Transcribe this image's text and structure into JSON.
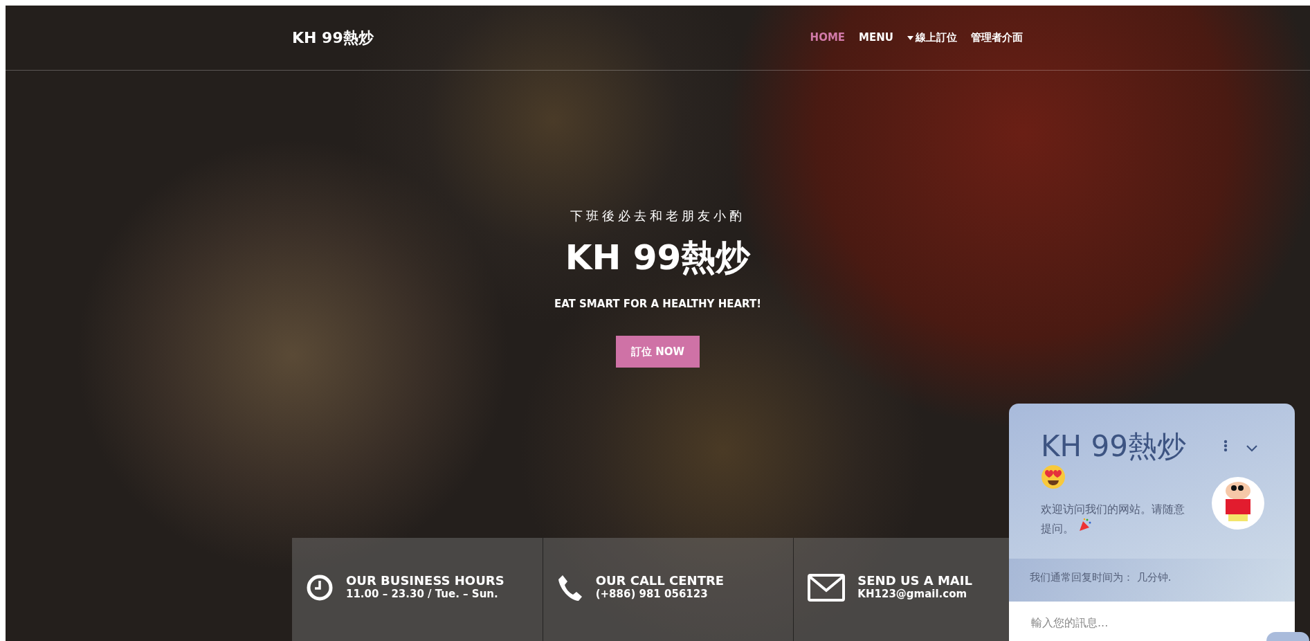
{
  "navbar": {
    "brand": "KH 99熱炒",
    "links": [
      {
        "label": "HOME",
        "selected": true,
        "kind": "link"
      },
      {
        "label": "MENU",
        "selected": false,
        "kind": "link"
      },
      {
        "label": "線上訂位",
        "selected": false,
        "kind": "dropdown"
      },
      {
        "label": "管理者介面",
        "selected": false,
        "kind": "link"
      }
    ]
  },
  "hero": {
    "subtitle": "下班後必去和老朋友小酌",
    "title": "KH 99熱炒",
    "tagline": "EAT SMART FOR A HEALTHY HEART!",
    "button": "訂位 NOW"
  },
  "info": [
    {
      "kind": "clock",
      "title": "OUR BUSINESS HOURS",
      "detail": "11.00 – 23.30 / Tue. – Sun."
    },
    {
      "kind": "phone",
      "title": "OUR CALL CENTRE",
      "detail": "(+886) 981 056123"
    },
    {
      "kind": "mail",
      "title": "SEND US A MAIL",
      "detail": "KH123@gmail.com"
    }
  ],
  "chat": {
    "title": "KH 99熱炒",
    "greeting": "欢迎访问我们的网站。请随意提问。",
    "reply_time": "我们通常回复时间为： 几分钟.",
    "placeholder": "輸入您的訊息..."
  }
}
